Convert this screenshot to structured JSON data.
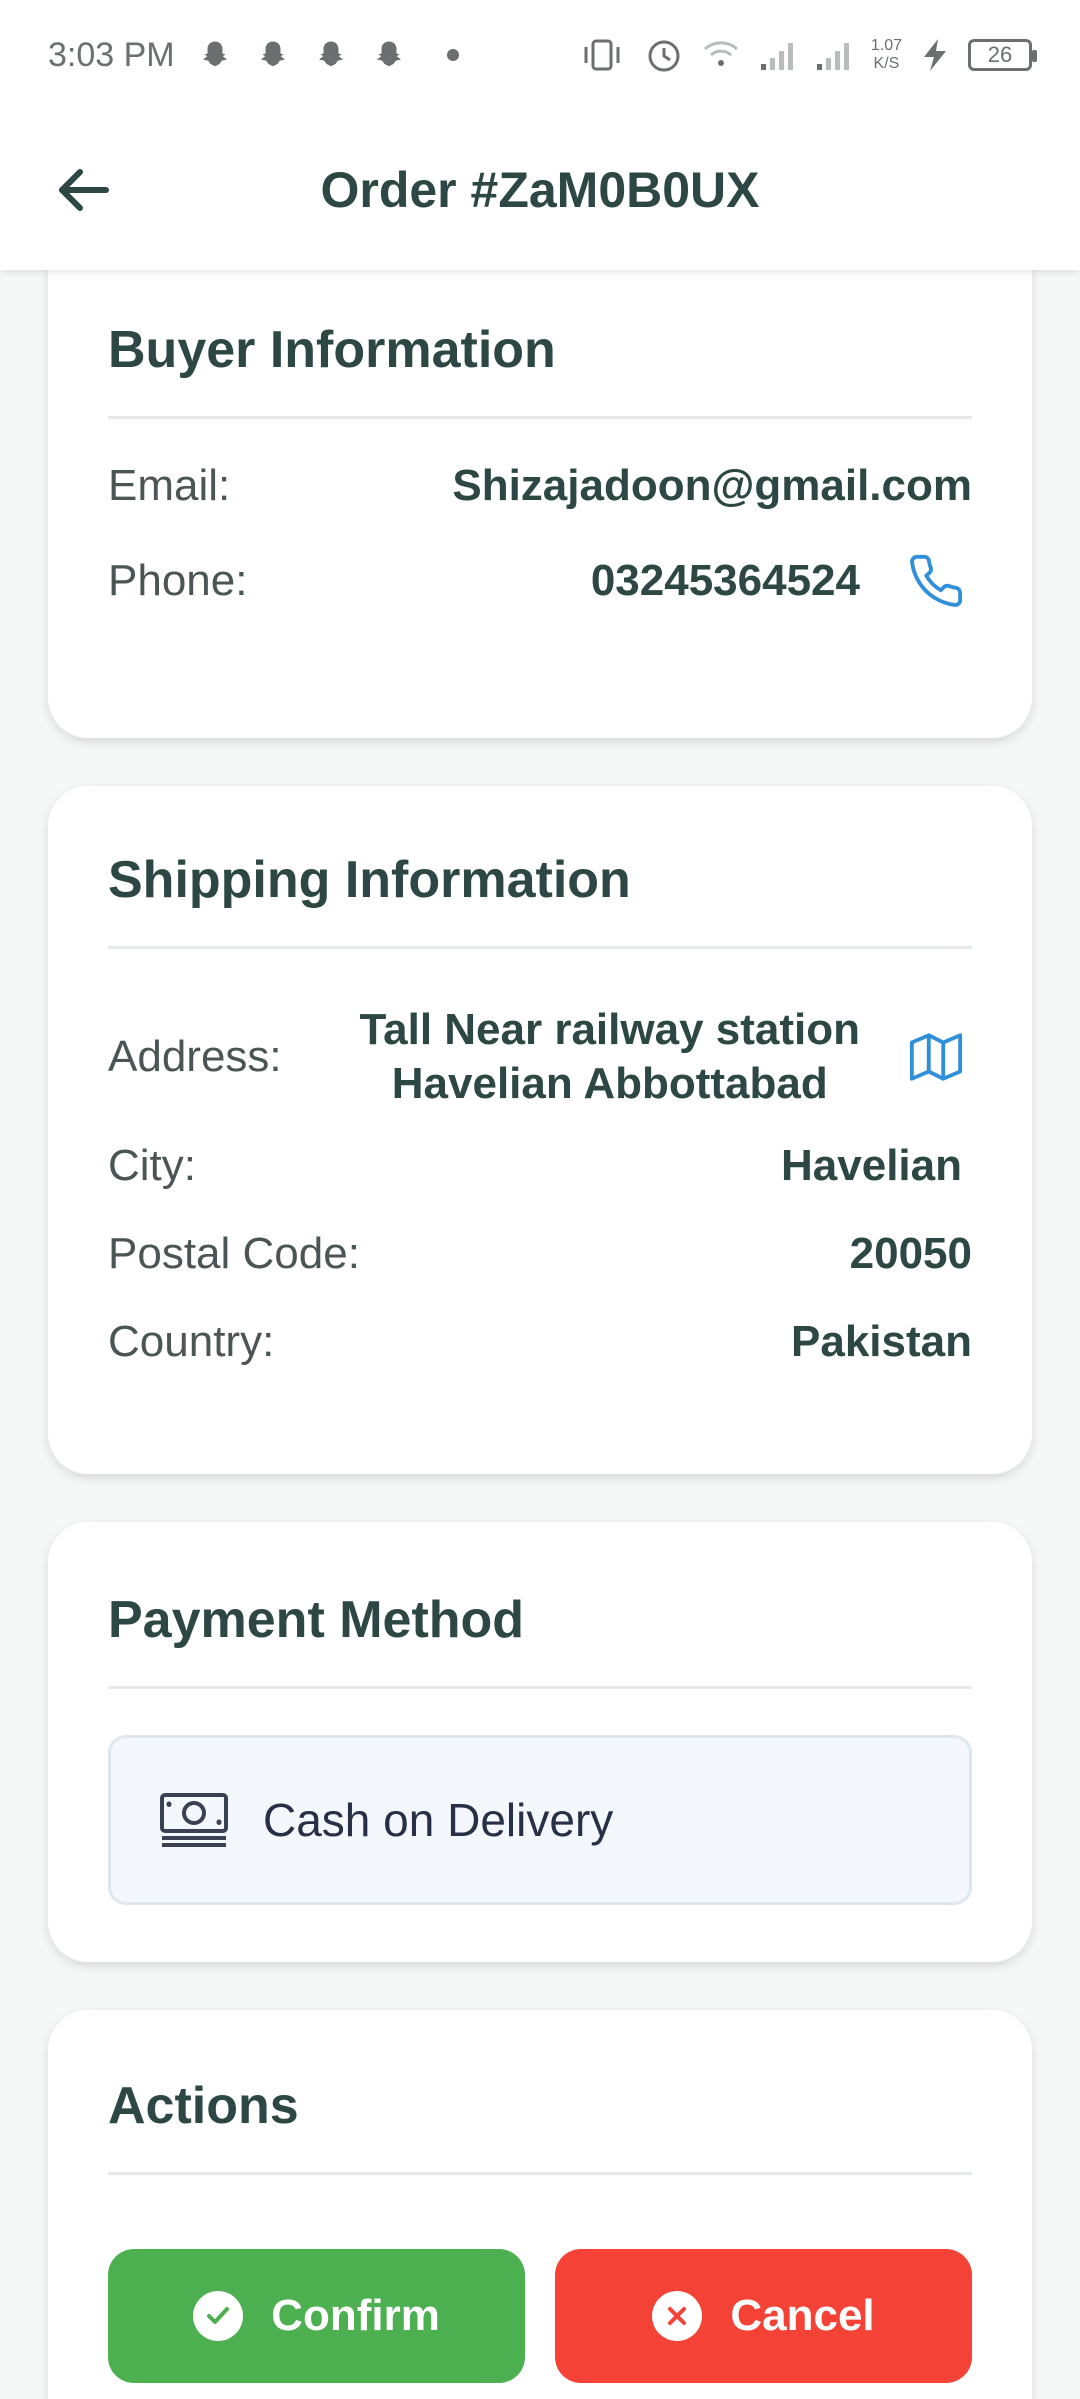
{
  "status_bar": {
    "time": "3:03 PM",
    "network_speed_value": "1.07",
    "network_speed_unit": "K/S",
    "battery_level": "26"
  },
  "header": {
    "title": "Order #ZaM0B0UX"
  },
  "buyer": {
    "title": "Buyer Information",
    "email_label": "Email:",
    "email_value": "Shizajadoon@gmail.com",
    "phone_label": "Phone:",
    "phone_value": "03245364524"
  },
  "shipping": {
    "title": "Shipping Information",
    "address_label": "Address:",
    "address_line1": "Tall Near railway station",
    "address_line2": "Havelian Abbottabad",
    "city_label": "City:",
    "city_value": "Havelian",
    "postal_label": "Postal Code:",
    "postal_value": "20050",
    "country_label": "Country:",
    "country_value": "Pakistan"
  },
  "payment": {
    "title": "Payment Method",
    "method": "Cash on Delivery"
  },
  "actions": {
    "title": "Actions",
    "confirm_label": "Confirm",
    "cancel_label": "Cancel"
  },
  "colors": {
    "primary_text": "#2c4744",
    "link_blue": "#2f8fd8",
    "confirm_green": "#4caf50",
    "cancel_red": "#f44336"
  }
}
